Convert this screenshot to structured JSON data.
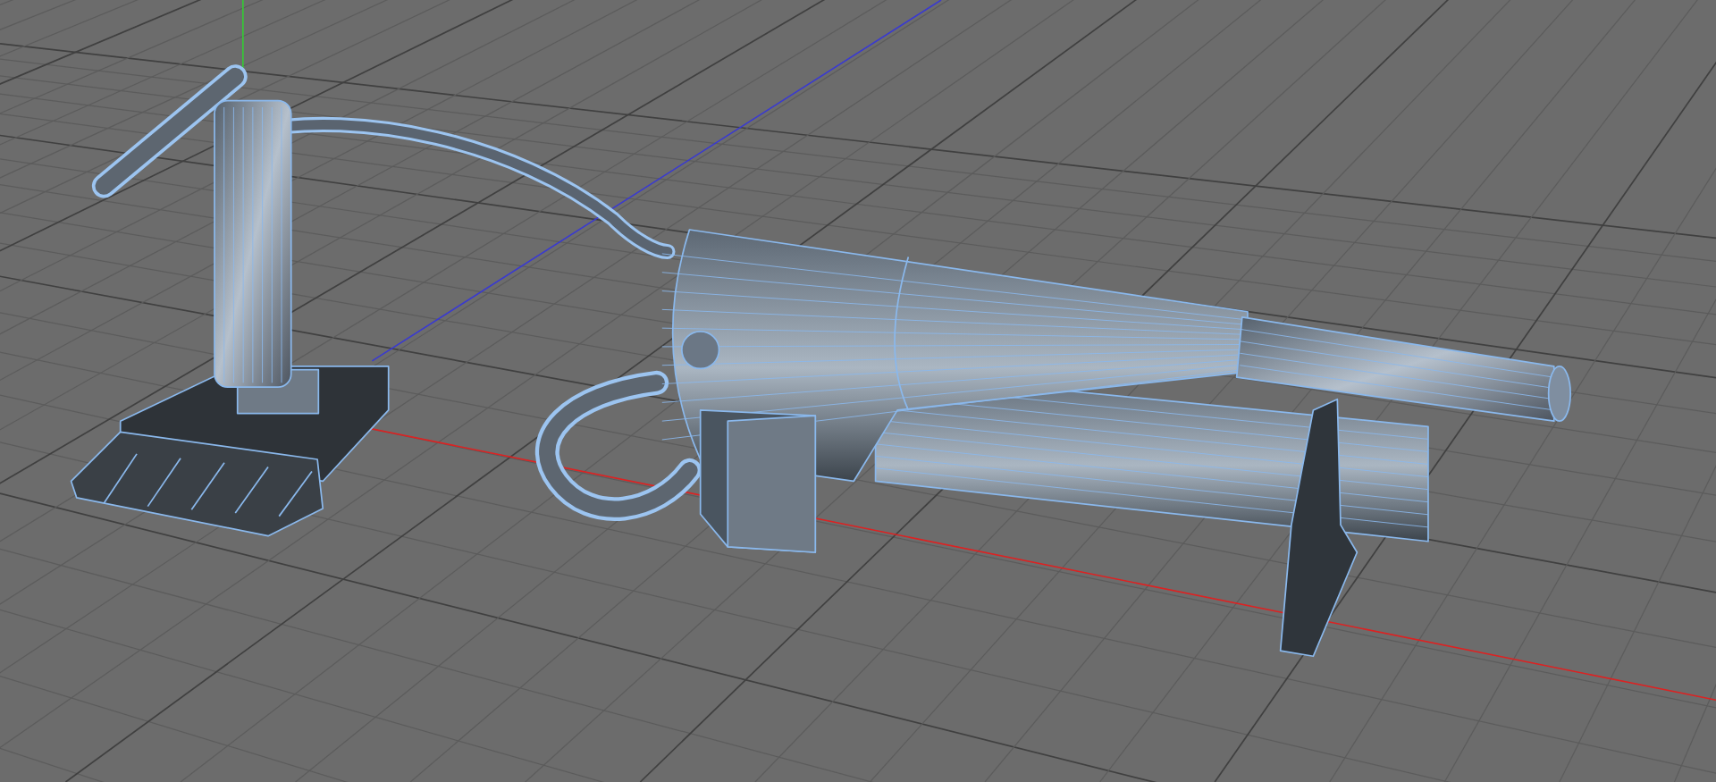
{
  "viewport": {
    "model": {
      "selected": true
    }
  }
}
